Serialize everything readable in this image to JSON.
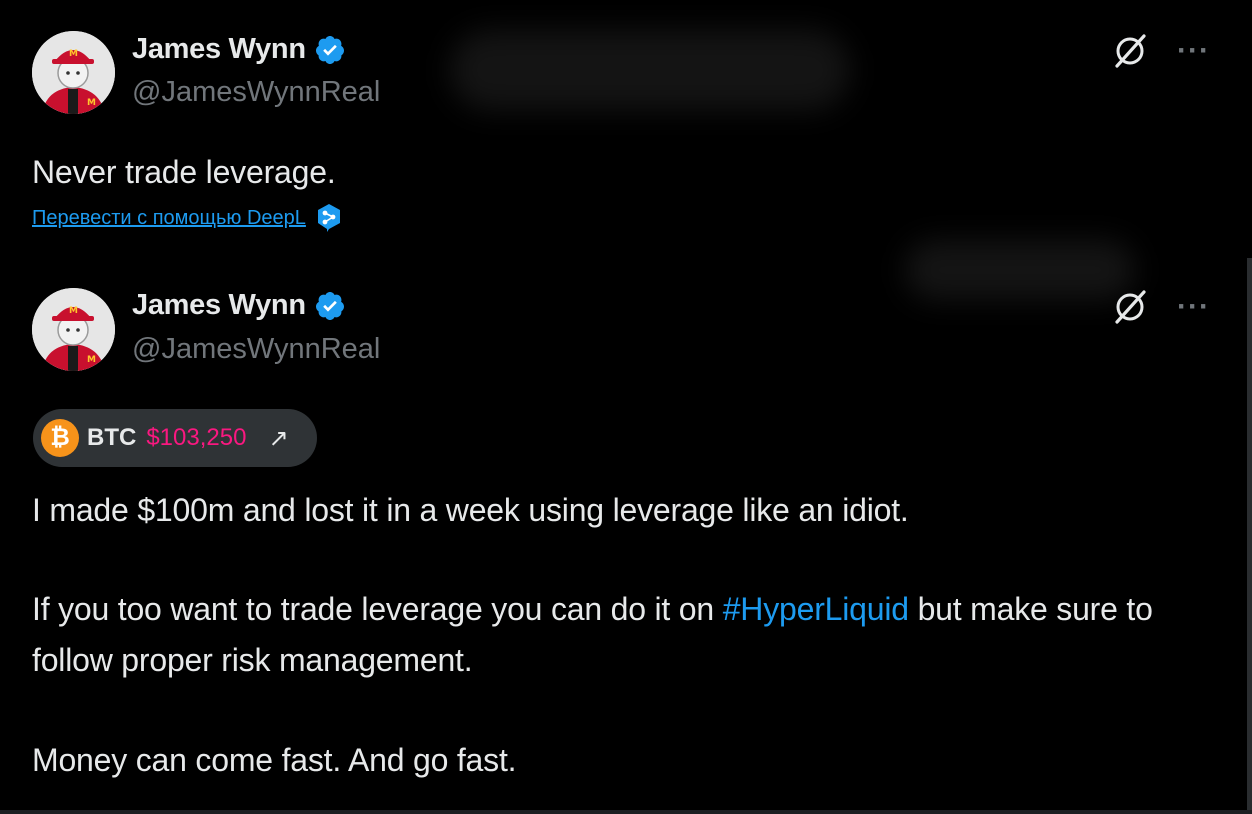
{
  "colors": {
    "background": "#000000",
    "text_primary": "#e7e9ea",
    "text_secondary": "#71767b",
    "link": "#1d9bf0",
    "verified": "#1d9bf0",
    "price": "#f91880",
    "btc_orange": "#f7931a",
    "chip_bg": "#2f3336"
  },
  "tweets": [
    {
      "author": {
        "name": "James Wynn",
        "handle": "@JamesWynnReal",
        "verified_icon": "verified-badge-icon"
      },
      "text": "Never trade leverage.",
      "translate_label": "Перевести с помощью DeepL",
      "translate_icon": "deepl-icon",
      "actions": {
        "grok_icon": "grok-icon",
        "more_label": "···"
      }
    },
    {
      "author": {
        "name": "James Wynn",
        "handle": "@JamesWynnReal",
        "verified_icon": "verified-badge-icon"
      },
      "ticker": {
        "icon": "bitcoin-icon",
        "coin_glyph": "₿",
        "symbol": "BTC",
        "price": "$103,250",
        "arrow": "↗"
      },
      "paragraphs": {
        "p1": "I made $100m and lost it in a week using leverage like an idiot.",
        "p2_before": "If you too want to trade leverage you can do it on ",
        "p2_hashtag": "#HyperLiquid",
        "p2_after": " but make sure to follow proper risk management.",
        "p3": "Money can come fast. And go fast."
      },
      "actions": {
        "grok_icon": "grok-icon",
        "more_label": "···"
      }
    }
  ]
}
